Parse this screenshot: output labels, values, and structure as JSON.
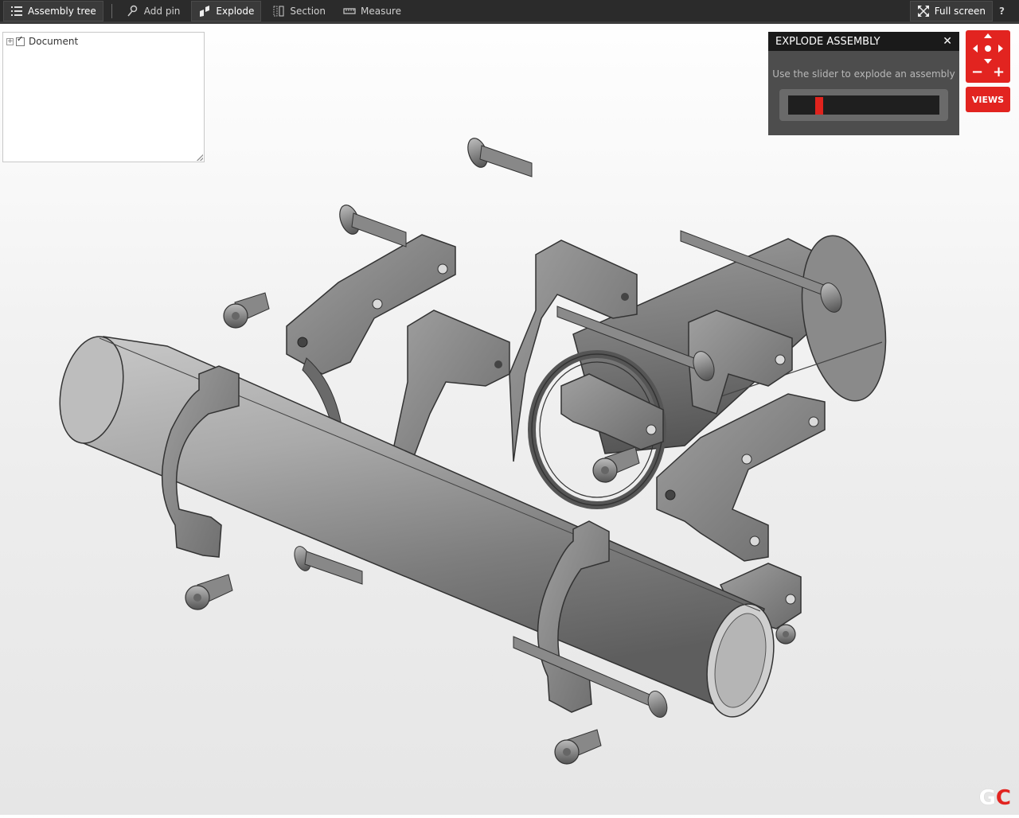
{
  "toolbar": {
    "assembly_tree": "Assembly tree",
    "add_pin": "Add pin",
    "explode": "Explode",
    "section": "Section",
    "measure": "Measure",
    "full_screen": "Full screen",
    "help": "?"
  },
  "tree": {
    "root_label": "Document",
    "root_checked": true
  },
  "explode_panel": {
    "title": "EXPLODE ASSEMBLY",
    "hint": "Use the slider to explode an assembly",
    "slider_value": 0.19
  },
  "nav": {
    "views_label": "VIEWS",
    "zoom_out": "−",
    "zoom_in": "+"
  },
  "logo": {
    "g": "G",
    "c": "C"
  },
  "colors": {
    "accent": "#e22420",
    "toolbar_bg": "#2b2b2b",
    "panel_bg": "#4d4d4d"
  },
  "icons": {
    "assembly_tree": "list-icon",
    "add_pin": "pin-icon",
    "explode": "explode-icon",
    "section": "section-icon",
    "measure": "ruler-icon",
    "full_screen": "fullscreen-icon",
    "close": "close-icon"
  }
}
